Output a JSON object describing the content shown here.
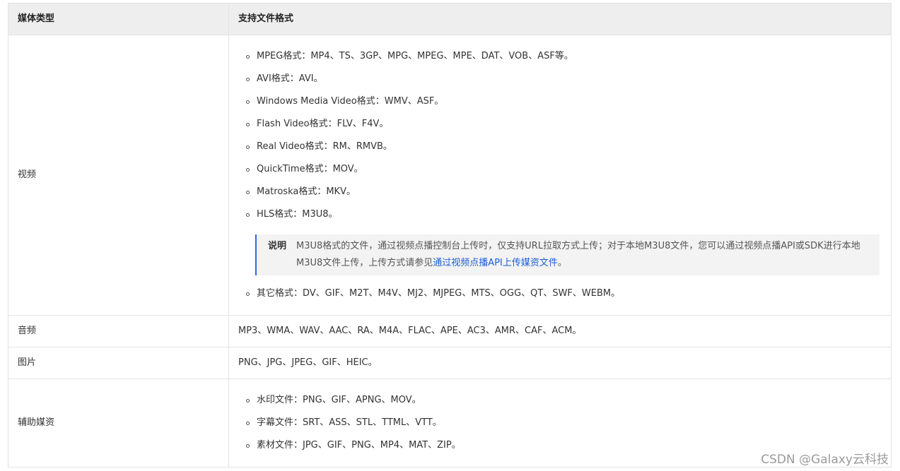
{
  "table": {
    "headers": [
      "媒体类型",
      "支持文件格式"
    ],
    "video": {
      "type": "视频",
      "items": [
        "MPEG格式：MP4、TS、3GP、MPG、MPEG、MPE、DAT、VOB、ASF等。",
        "AVI格式：AVI。",
        "Windows Media Video格式：WMV、ASF。",
        "Flash Video格式：FLV、F4V。",
        "Real Video格式：RM、RMVB。",
        "QuickTime格式：MOV。",
        "Matroska格式：MKV。",
        "HLS格式：M3U8。"
      ],
      "note": {
        "label": "说明",
        "text": "M3U8格式的文件，通过视频点播控制台上传时，仅支持URL拉取方式上传；对于本地M3U8文件，您可以通过视频点播API或SDK进行本地M3U8文件上传，上传方式请参见",
        "link": "通过视频点播API上传媒资文件",
        "suffix": "。"
      },
      "last_item": "其它格式：DV、GIF、M2T、M4V、MJ2、MJPEG、MTS、OGG、QT、SWF、WEBM。"
    },
    "audio": {
      "type": "音频",
      "formats": "MP3、WMA、WAV、AAC、RA、M4A、FLAC、APE、AC3、AMR、CAF、ACM。"
    },
    "image": {
      "type": "图片",
      "formats": "PNG、JPG、JPEG、GIF、HEIC。"
    },
    "aux": {
      "type": "辅助媒资",
      "items": [
        "水印文件：PNG、GIF、APNG、MOV。",
        "字幕文件：SRT、ASS、STL、TTML、VTT。",
        "素材文件：JPG、GIF、PNG、MP4、MAT、ZIP。"
      ]
    }
  },
  "watermark": "CSDN @Galaxy云科技"
}
